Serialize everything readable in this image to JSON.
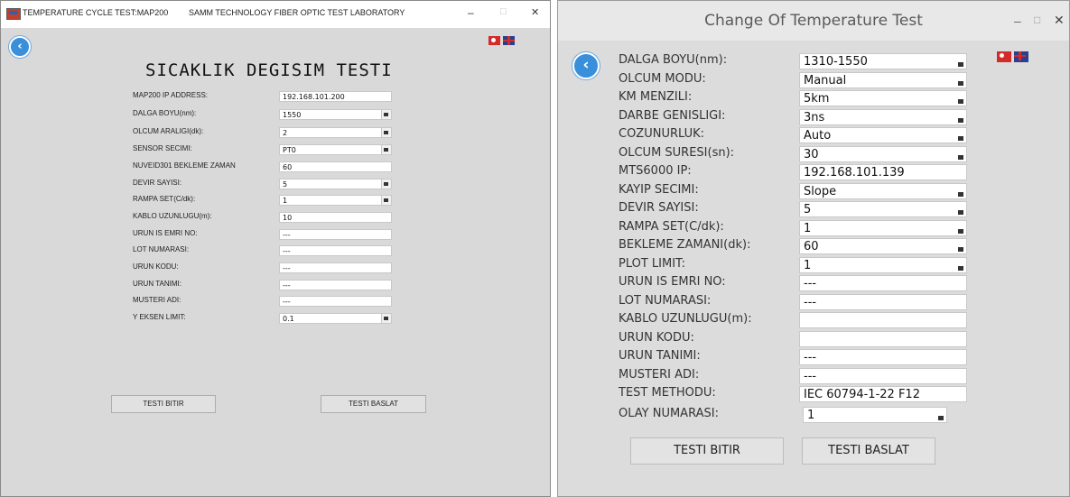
{
  "window1": {
    "app_title": "TEMPERATURE CYCLE TEST:MAP200",
    "lab_title": "SAMM TECHNOLOGY FIBER OPTIC TEST LABORATORY",
    "controls": {
      "minimize": "–",
      "maximize": "□",
      "close": "✕"
    },
    "back_glyph": "‹",
    "heading": "SICAKLIK DEGISIM TESTI",
    "fields": [
      {
        "label": "MAP200 IP ADDRESS:",
        "value": "192.168.101.200"
      },
      {
        "label": "DALGA BOYU(nm):",
        "value": "1550"
      },
      {
        "label": "OLCUM ARALIGI(dk):",
        "value": "2"
      },
      {
        "label": "SENSOR SECIMI:",
        "value": "PT0"
      },
      {
        "label": "NUVEID301 BEKLEME ZAMAN",
        "value": "60"
      },
      {
        "label": "DEVIR SAYISI:",
        "value": "5"
      },
      {
        "label": "RAMPA SET(C/dk):",
        "value": "1"
      },
      {
        "label": "KABLO UZUNLUGU(m):",
        "value": "10"
      },
      {
        "label": "URUN IS EMRI NO:",
        "value": "---"
      },
      {
        "label": "LOT NUMARASI:",
        "value": "---"
      },
      {
        "label": "URUN KODU:",
        "value": "---"
      },
      {
        "label": "URUN TANIMI:",
        "value": "---"
      },
      {
        "label": "MUSTERI ADI:",
        "value": "---"
      },
      {
        "label": "Y EKSEN LIMIT:",
        "value": "0.1"
      }
    ],
    "stop_button": "TESTI BITIR",
    "start_button": "TESTI BASLAT"
  },
  "window2": {
    "title": "Change Of Temperature Test",
    "controls": {
      "minimize": "–",
      "maximize": "□",
      "close": "✕"
    },
    "back_glyph": "‹",
    "fields": [
      {
        "label": "DALGA BOYU(nm):",
        "value": "1310-1550"
      },
      {
        "label": "OLCUM MODU:",
        "value": "Manual"
      },
      {
        "label": "KM MENZILI:",
        "value": "5km"
      },
      {
        "label": "DARBE GENISLIGI:",
        "value": "3ns"
      },
      {
        "label": "COZUNURLUK:",
        "value": "Auto"
      },
      {
        "label": "OLCUM SURESI(sn):",
        "value": "30"
      },
      {
        "label": "MTS6000 IP:",
        "value": "192.168.101.139"
      },
      {
        "label": "KAYIP SECIMI:",
        "value": "Slope"
      },
      {
        "label": "DEVIR SAYISI:",
        "value": "5"
      },
      {
        "label": "RAMPA SET(C/dk):",
        "value": "1"
      },
      {
        "label": "BEKLEME ZAMANI(dk):",
        "value": "60"
      },
      {
        "label": "PLOT LIMIT:",
        "value": "1"
      },
      {
        "label": "URUN IS EMRI NO:",
        "value": "---"
      },
      {
        "label": "LOT NUMARASI:",
        "value": "---"
      },
      {
        "label": "KABLO UZUNLUGU(m):",
        "value": ""
      },
      {
        "label": "URUN KODU:",
        "value": ""
      },
      {
        "label": "URUN TANIMI:",
        "value": "---"
      },
      {
        "label": "MUSTERI ADI:",
        "value": "---"
      },
      {
        "label": "TEST METHODU:",
        "value": "IEC 60794-1-22 F12"
      },
      {
        "label": "OLAY NUMARASI:",
        "value": "1"
      }
    ],
    "stop_button": "TESTI BITIR",
    "start_button": "TESTI BASLAT"
  },
  "colors": {
    "back_button": "#3a8fdb",
    "window_bg": "#d9d9d9",
    "field_bg": "#ffffff"
  }
}
